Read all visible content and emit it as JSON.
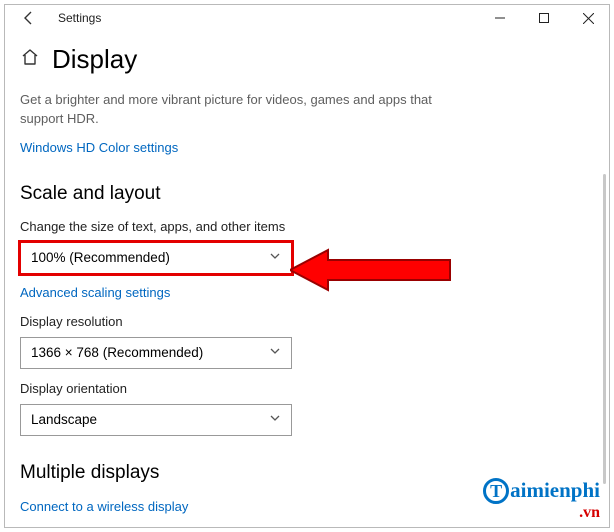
{
  "window": {
    "title": "Settings"
  },
  "page": {
    "title": "Display"
  },
  "hdr": {
    "description": "Get a brighter and more vibrant picture for videos, games and apps that support HDR.",
    "link": "Windows HD Color settings"
  },
  "scale": {
    "heading": "Scale and layout",
    "size_label": "Change the size of text, apps, and other items",
    "size_value": "100% (Recommended)",
    "advanced_link": "Advanced scaling settings",
    "resolution_label": "Display resolution",
    "resolution_value": "1366 × 768 (Recommended)",
    "orientation_label": "Display orientation",
    "orientation_value": "Landscape"
  },
  "multi": {
    "heading": "Multiple displays",
    "connect_link": "Connect to a wireless display"
  },
  "watermark": {
    "brand": "aimienphi",
    "suffix": ".vn"
  }
}
